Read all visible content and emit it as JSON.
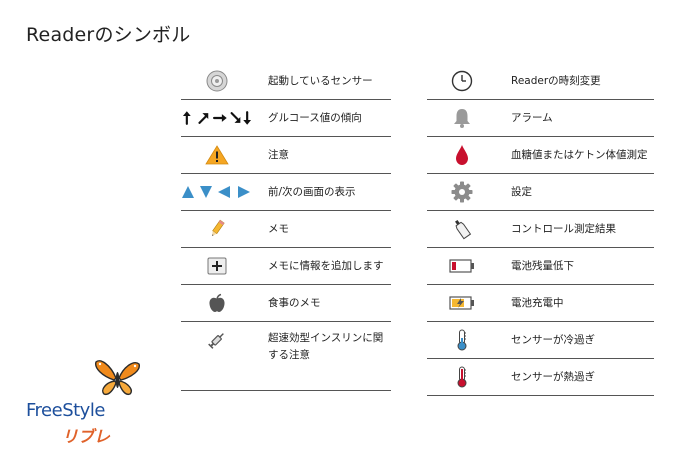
{
  "title": "Readerのシンボル",
  "left_rows": [
    {
      "label": "起動しているセンサー",
      "icon": "sensor-icon"
    },
    {
      "label": "グルコース値の傾向",
      "icon": "trend-arrows-icon"
    },
    {
      "label": "注意",
      "icon": "caution-icon"
    },
    {
      "label": "前/次の画面の表示",
      "icon": "nav-arrows-icon"
    },
    {
      "label": "メモ",
      "icon": "pencil-icon"
    },
    {
      "label": "メモに情報を追加します",
      "icon": "plus-icon"
    },
    {
      "label": "食事のメモ",
      "icon": "apple-icon"
    },
    {
      "label": "超速効型インスリンに関",
      "label2": "する注意",
      "icon": "syringe-icon"
    }
  ],
  "right_rows": [
    {
      "label": "Readerの時刻変更",
      "icon": "clock-icon"
    },
    {
      "label": "アラーム",
      "icon": "bell-icon"
    },
    {
      "label": "血糖値またはケトン体値測定",
      "icon": "blood-drop-icon"
    },
    {
      "label": "設定",
      "icon": "gear-icon"
    },
    {
      "label": "コントロール測定結果",
      "icon": "control-solution-icon"
    },
    {
      "label": "電池残量低下",
      "icon": "battery-low-icon"
    },
    {
      "label": "電池充電中",
      "icon": "battery-charging-icon"
    },
    {
      "label": "センサーが冷過ぎ",
      "icon": "thermometer-cold-icon"
    },
    {
      "label": "センサーが熱過ぎ",
      "icon": "thermometer-hot-icon"
    }
  ],
  "logo": {
    "brand": "FreeStyle",
    "sub": "リブレ"
  },
  "colors": {
    "blue": "#3b8fc8",
    "orange": "#f5a623",
    "red": "#c8102e",
    "brand_blue": "#1d4f9c",
    "brand_orange": "#e0622a"
  }
}
